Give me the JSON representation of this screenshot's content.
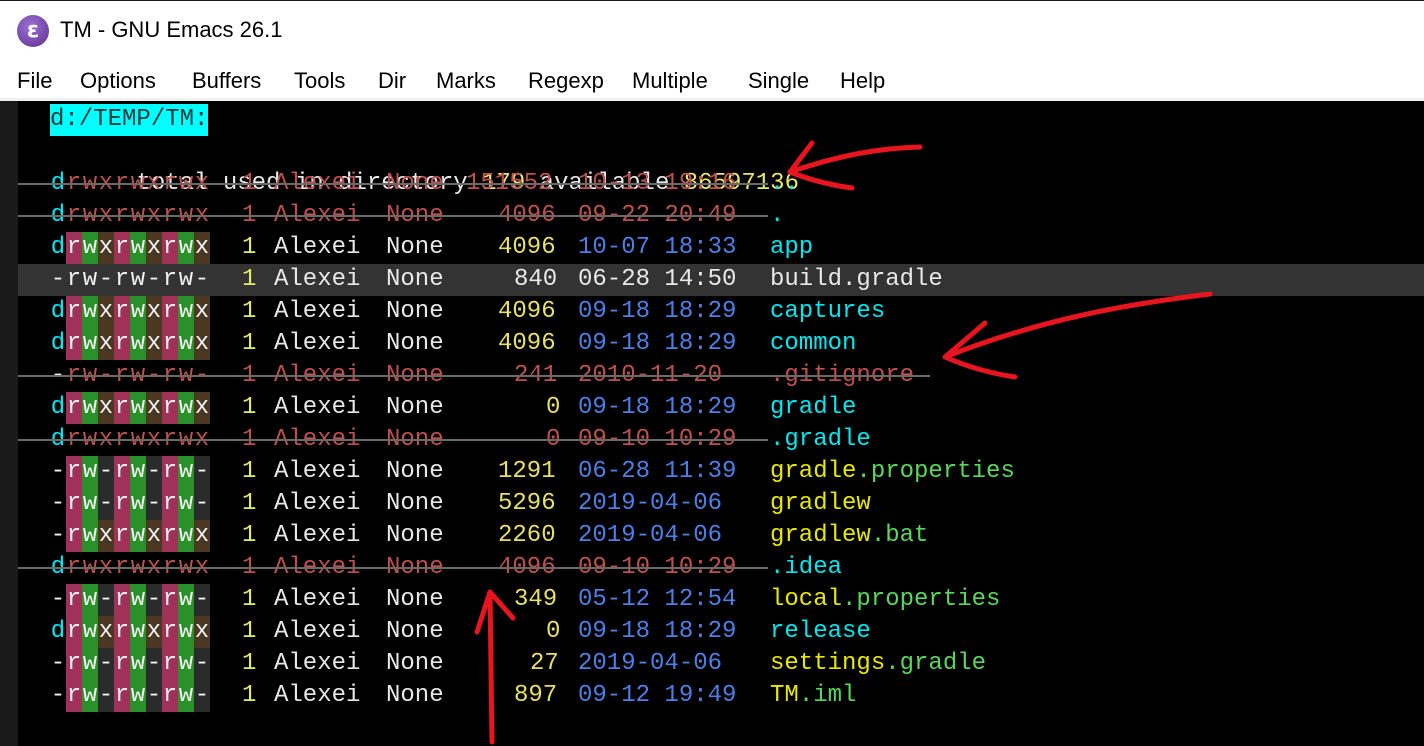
{
  "window": {
    "title": "TM - GNU Emacs 26.1",
    "icon": "emacs-icon"
  },
  "menubar": {
    "items": [
      "File",
      "Options",
      "Buffers",
      "Tools",
      "Dir",
      "Marks",
      "Regexp",
      "Multiple",
      "Single",
      "Help"
    ]
  },
  "dired": {
    "header": "d:/TEMP/TM:",
    "summary": {
      "prefix": "total used in directory",
      "used": "179",
      "mid": "available",
      "available": "86597136"
    },
    "entries": [
      {
        "perms": "drwxrwxrwx",
        "links": "1",
        "owner": "Alexei",
        "group": "None",
        "size": "151552",
        "date": "10-13 19:16",
        "name": "..",
        "ignored": true,
        "type": "dir"
      },
      {
        "perms": "drwxrwxrwx",
        "links": "1",
        "owner": "Alexei",
        "group": "None",
        "size": "4096",
        "date": "09-22 20:49",
        "name": ".",
        "ignored": true,
        "type": "dir"
      },
      {
        "perms": "drwxrwxrwx",
        "links": "1",
        "owner": "Alexei",
        "group": "None",
        "size": "4096",
        "date": "10-07 18:33",
        "name": "app",
        "ignored": false,
        "type": "dir"
      },
      {
        "perms": "-rw-rw-rw-",
        "links": "1",
        "owner": "Alexei",
        "group": "None",
        "size": "840",
        "date": "06-28 14:50",
        "name": "build.gradle",
        "ignored": false,
        "type": "current"
      },
      {
        "perms": "drwxrwxrwx",
        "links": "1",
        "owner": "Alexei",
        "group": "None",
        "size": "4096",
        "date": "09-18 18:29",
        "name": "captures",
        "ignored": false,
        "type": "dir"
      },
      {
        "perms": "drwxrwxrwx",
        "links": "1",
        "owner": "Alexei",
        "group": "None",
        "size": "4096",
        "date": "09-18 18:29",
        "name": "common",
        "ignored": false,
        "type": "dir"
      },
      {
        "perms": "-rw-rw-rw-",
        "links": "1",
        "owner": "Alexei",
        "group": "None",
        "size": "241",
        "date": "2010-11-20 ",
        "name": ".gitignore",
        "ignored": true,
        "type": "file"
      },
      {
        "perms": "drwxrwxrwx",
        "links": "1",
        "owner": "Alexei",
        "group": "None",
        "size": "0",
        "date": "09-18 18:29",
        "name": "gradle",
        "ignored": false,
        "type": "dir"
      },
      {
        "perms": "drwxrwxrwx",
        "links": "1",
        "owner": "Alexei",
        "group": "None",
        "size": "0",
        "date": "09-10 10:29",
        "name": ".gradle",
        "ignored": true,
        "type": "dir"
      },
      {
        "perms": "-rw-rw-rw-",
        "links": "1",
        "owner": "Alexei",
        "group": "None",
        "size": "1291",
        "date": "06-28 11:39",
        "name": "gradle.properties",
        "ignored": false,
        "type": "props",
        "base": "gradle",
        "ext": ".properties"
      },
      {
        "perms": "-rw-rw-rw-",
        "links": "1",
        "owner": "Alexei",
        "group": "None",
        "size": "5296",
        "date": "2019-04-06 ",
        "name": "gradlew",
        "ignored": false,
        "type": "exec"
      },
      {
        "perms": "-rwxrwxrwx",
        "links": "1",
        "owner": "Alexei",
        "group": "None",
        "size": "2260",
        "date": "2019-04-06 ",
        "name": "gradlew.bat",
        "ignored": false,
        "type": "props",
        "base": "gradlew",
        "ext": ".bat"
      },
      {
        "perms": "drwxrwxrwx",
        "links": "1",
        "owner": "Alexei",
        "group": "None",
        "size": "4096",
        "date": "09-10 10:29",
        "name": ".idea",
        "ignored": true,
        "type": "dir"
      },
      {
        "perms": "-rw-rw-rw-",
        "links": "1",
        "owner": "Alexei",
        "group": "None",
        "size": "349",
        "date": "05-12 12:54",
        "name": "local.properties",
        "ignored": false,
        "type": "props",
        "base": "local",
        "ext": ".properties"
      },
      {
        "perms": "drwxrwxrwx",
        "links": "1",
        "owner": "Alexei",
        "group": "None",
        "size": "0",
        "date": "09-18 18:29",
        "name": "release",
        "ignored": false,
        "type": "dir"
      },
      {
        "perms": "-rw-rw-rw-",
        "links": "1",
        "owner": "Alexei",
        "group": "None",
        "size": "27",
        "date": "2019-04-06 ",
        "name": "settings.gradle",
        "ignored": false,
        "type": "props",
        "base": "settings",
        "ext": ".gradle"
      },
      {
        "perms": "-rw-rw-rw-",
        "links": "1",
        "owner": "Alexei",
        "group": "None",
        "size": "897",
        "date": "09-12 19:49",
        "name": "TM.iml",
        "ignored": false,
        "type": "props",
        "base": "TM",
        "ext": ".iml"
      }
    ]
  },
  "annotations": {
    "arrow_color": "#e8141e",
    "arrows": [
      "arrow-to-available",
      "arrow-to-gitignore",
      "arrow-up-to-size-column"
    ]
  },
  "colors": {
    "header_bg": "#00ffff",
    "dir_name": "#00e8f0",
    "size": "#e8e060",
    "date": "#4c7fe8",
    "ignored": "#c0504e",
    "current_line": "#333333"
  }
}
